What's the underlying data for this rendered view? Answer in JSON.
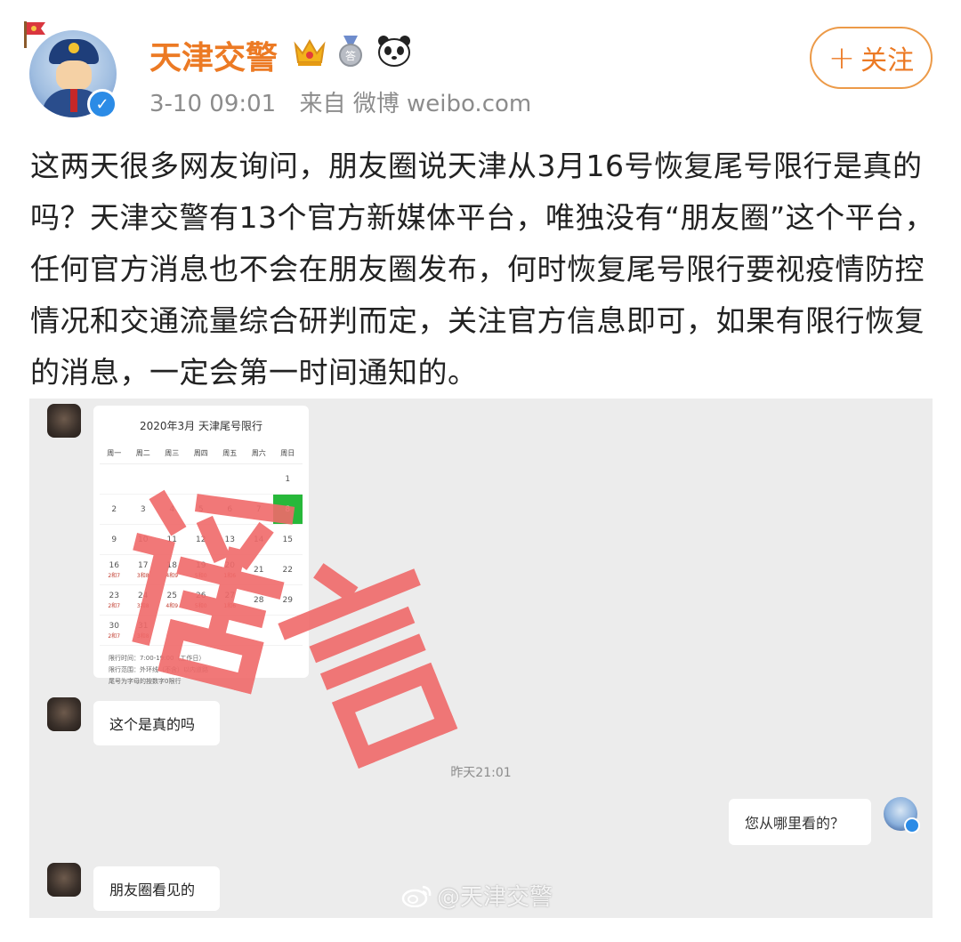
{
  "header": {
    "username": "天津交警",
    "time": "3-10 09:01",
    "source": "来自 微博 weibo.com",
    "follow_label": "关注",
    "follow_plus": "+"
  },
  "post": {
    "lines": [
      "这两天很多网友询问，朋友圈说天津从3月16号恢复尾号限行是真的",
      "吗？天津交警有13个官方新媒体平台，唯独没有“朋友圈”这个平台，",
      "任何官方消息也不会在朋友圈发布，何时恢复尾号限行要视疫情防控",
      "情况和交通流量综合研判而定，关注官方信息即可，如果有限行恢复",
      "的消息，一定会第一时间通知的。"
    ]
  },
  "chat": {
    "calendar": {
      "title": "2020年3月 天津尾号限行",
      "weekdays": [
        "周一",
        "周二",
        "周三",
        "周四",
        "周五",
        "周六",
        "周日"
      ],
      "rows": [
        [
          {
            "d": "",
            "r": ""
          },
          {
            "d": "",
            "r": ""
          },
          {
            "d": "",
            "r": ""
          },
          {
            "d": "",
            "r": ""
          },
          {
            "d": "",
            "r": ""
          },
          {
            "d": "",
            "r": ""
          },
          {
            "d": "1",
            "r": ""
          }
        ],
        [
          {
            "d": "2",
            "r": ""
          },
          {
            "d": "3",
            "r": ""
          },
          {
            "d": "4",
            "r": ""
          },
          {
            "d": "5",
            "r": ""
          },
          {
            "d": "6",
            "r": ""
          },
          {
            "d": "7",
            "r": ""
          },
          {
            "d": "8",
            "r": "",
            "hl": true
          }
        ],
        [
          {
            "d": "9",
            "r": ""
          },
          {
            "d": "10",
            "r": ""
          },
          {
            "d": "11",
            "r": ""
          },
          {
            "d": "12",
            "r": ""
          },
          {
            "d": "13",
            "r": ""
          },
          {
            "d": "14",
            "r": ""
          },
          {
            "d": "15",
            "r": ""
          }
        ],
        [
          {
            "d": "16",
            "r": "2和7"
          },
          {
            "d": "17",
            "r": "3和8"
          },
          {
            "d": "18",
            "r": "4和9"
          },
          {
            "d": "19",
            "r": "5和0"
          },
          {
            "d": "20",
            "r": "1和6"
          },
          {
            "d": "21",
            "r": ""
          },
          {
            "d": "22",
            "r": ""
          }
        ],
        [
          {
            "d": "23",
            "r": "2和7"
          },
          {
            "d": "24",
            "r": "3和8"
          },
          {
            "d": "25",
            "r": "4和9"
          },
          {
            "d": "26",
            "r": "5和0"
          },
          {
            "d": "27",
            "r": "1和6"
          },
          {
            "d": "28",
            "r": ""
          },
          {
            "d": "29",
            "r": ""
          }
        ],
        [
          {
            "d": "30",
            "r": "2和7"
          },
          {
            "d": "31",
            "r": "3和8"
          },
          {
            "d": "",
            "r": ""
          },
          {
            "d": "",
            "r": ""
          },
          {
            "d": "",
            "r": ""
          },
          {
            "d": "",
            "r": ""
          },
          {
            "d": "",
            "r": ""
          }
        ]
      ],
      "notes": [
        "限行时间：7:00-19:00（工作日）",
        "限行范围：外环线（不含）以内道路",
        "尾号为字母的按数字0限行"
      ]
    },
    "message1": "这个是真的吗",
    "timestamp": "昨天21:01",
    "message2": "您从哪里看的？",
    "message3": "朋友圈看见的",
    "stamp_text": "谣言",
    "watermark": "@天津交警"
  },
  "colors": {
    "username": "#ec7a24",
    "follow_border": "#ec9a48",
    "verify": "#2b8be6",
    "highlight": "#27b83a",
    "stamp": "#f06a6a"
  },
  "icons": [
    "crown-icon",
    "medal-icon",
    "panda-icon",
    "verified-icon",
    "weibo-logo-icon"
  ]
}
